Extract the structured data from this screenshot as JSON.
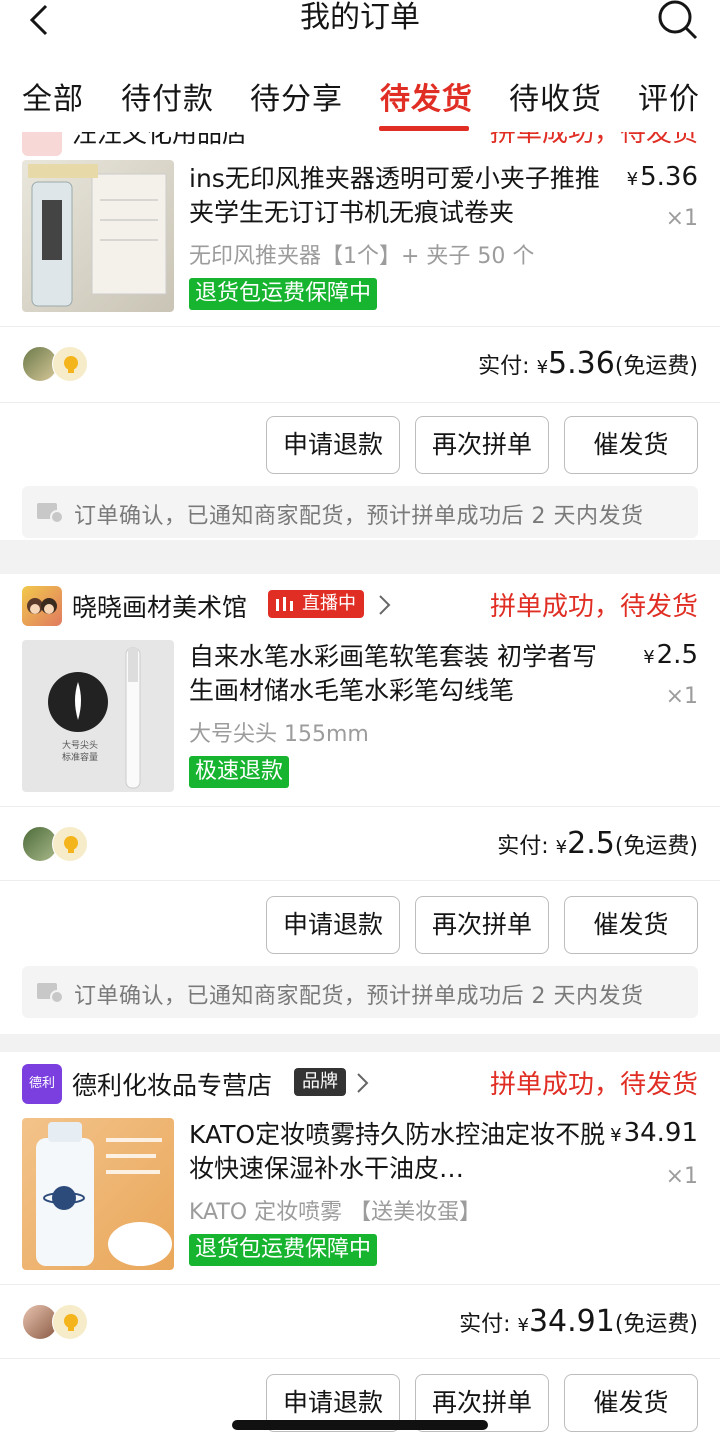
{
  "nav": {
    "title": "我的订单",
    "back_icon": "chevron-left-icon",
    "search_icon": "search-icon"
  },
  "tabs": [
    "全部",
    "待付款",
    "待分享",
    "待发货",
    "待收货",
    "评价"
  ],
  "active_tab": "待发货",
  "colors": {
    "accent": "#e02e24",
    "badge_green": "#16b42f",
    "live_red": "#e02e24",
    "brand_dark": "#333333"
  },
  "orders": [
    {
      "shop": {
        "name": "汪汪文化用品店",
        "status": "拼单成功，待发货"
      },
      "item": {
        "name": "ins无印风推夹器透明可爱小夹子推推夹学生无订订书机无痕试卷夹",
        "spec": "无印风推夹器【1个】+ 夹子 50 个",
        "currency": "¥",
        "price": "5.36",
        "qty": "×1",
        "badge": "退货包运费保障中"
      },
      "payment": {
        "label": "实付:",
        "currency": "¥",
        "amount": "5.36",
        "shipping": "(免运费)"
      },
      "buttons": [
        "申请退款",
        "再次拼单",
        "催发货"
      ],
      "notice": "订单确认，已通知商家配货，预计拼单成功后 2 天内发货"
    },
    {
      "shop": {
        "name": "晓晓画材美术馆",
        "tag": "直播中",
        "status": "拼单成功，待发货"
      },
      "item": {
        "name": "自来水笔水彩画笔软笔套装 初学者写生画材储水毛笔水彩笔勾线笔",
        "spec": "大号尖头 155mm",
        "currency": "¥",
        "price": "2.5",
        "qty": "×1",
        "badge": "极速退款",
        "thumb_text": [
          "大号尖头",
          "标准容量"
        ]
      },
      "payment": {
        "label": "实付:",
        "currency": "¥",
        "amount": "2.5",
        "shipping": "(免运费)"
      },
      "buttons": [
        "申请退款",
        "再次拼单",
        "催发货"
      ],
      "notice": "订单确认，已通知商家配货，预计拼单成功后 2 天内发货"
    },
    {
      "shop": {
        "name": "德利化妆品专营店",
        "tag": "品牌",
        "logo_text": "德利",
        "status": "拼单成功，待发货"
      },
      "item": {
        "name": "KATO定妆喷雾持久防水控油定妆不脱妆快速保湿补水干油皮…",
        "spec": "KATO 定妆喷雾 【送美妆蛋】",
        "currency": "¥",
        "price": "34.91",
        "qty": "×1",
        "badge": "退货包运费保障中"
      },
      "payment": {
        "label": "实付:",
        "currency": "¥",
        "amount": "34.91",
        "shipping": "(免运费)"
      },
      "buttons": [
        "申请退款",
        "再次拼单",
        "催发货"
      ]
    }
  ]
}
